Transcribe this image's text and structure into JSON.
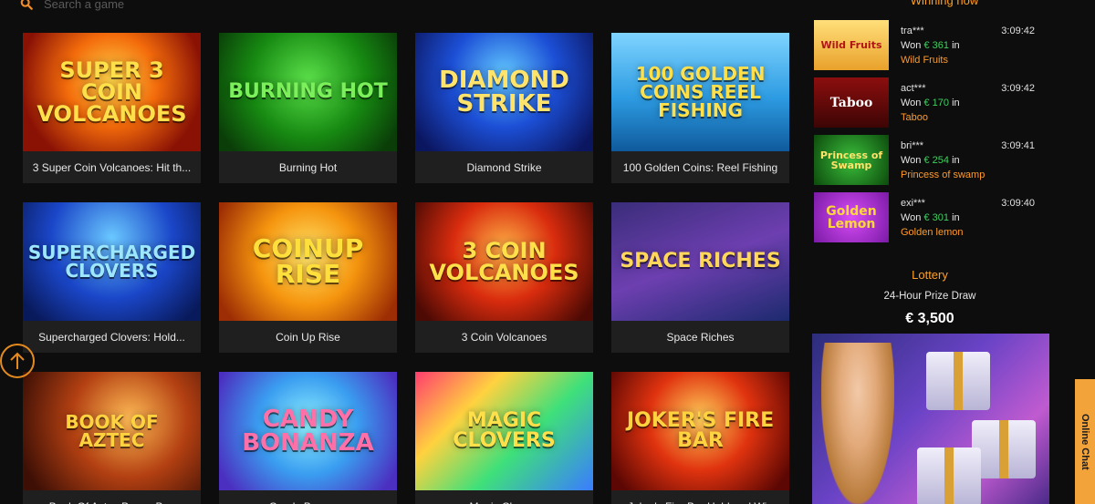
{
  "search": {
    "placeholder": "Search a game",
    "icon": "search-icon",
    "icon_color": "#f28c28"
  },
  "games": [
    {
      "name": "3 Super Coin Volcanoes: Hit th...",
      "art": "Super 3 Coin Volcanoes"
    },
    {
      "name": "Burning Hot",
      "art": "Burning Hot"
    },
    {
      "name": "Diamond Strike",
      "art": "Diamond Strike"
    },
    {
      "name": "100 Golden Coins: Reel Fishing",
      "art": "100 Golden Coins Reel Fishing"
    },
    {
      "name": "Supercharged Clovers: Hold...",
      "art": "Supercharged Clovers"
    },
    {
      "name": "Coin Up Rise",
      "art": "Coinup Rise"
    },
    {
      "name": "3 Coin Volcanoes",
      "art": "3 Coin Volcanoes"
    },
    {
      "name": "Space Riches",
      "art": "Space Riches"
    },
    {
      "name": "Book Of Aztec Bonus Buy",
      "art": "Book of Aztec"
    },
    {
      "name": "Candy Bonanza",
      "art": "Candy Bonanza"
    },
    {
      "name": "Magic Clovers",
      "art": "Magic Clovers"
    },
    {
      "name": "Joker's Fire Bar Hold and Win",
      "art": "Joker's Fire Bar"
    }
  ],
  "winners": {
    "title": "Winning now",
    "items": [
      {
        "user": "tra***",
        "time": "3:09:42",
        "won_label": "Won",
        "amount": "€ 361",
        "in_label": "in",
        "game": "Wild Fruits",
        "thumb": "Wild Fruits"
      },
      {
        "user": "act***",
        "time": "3:09:42",
        "won_label": "Won",
        "amount": "€ 170",
        "in_label": "in",
        "game": "Taboo",
        "thumb": "Taboo"
      },
      {
        "user": "bri***",
        "time": "3:09:41",
        "won_label": "Won",
        "amount": "€ 254",
        "in_label": "in",
        "game": "Princess of swamp",
        "thumb": "Princess of Swamp"
      },
      {
        "user": "exi***",
        "time": "3:09:40",
        "won_label": "Won",
        "amount": "€ 301",
        "in_label": "in",
        "game": "Golden lemon",
        "thumb": "Golden Lemon"
      }
    ]
  },
  "lottery": {
    "title": "Lottery",
    "subtitle": "24-Hour Prize Draw",
    "prize": "€ 3,500"
  },
  "chat": {
    "label": "Online Chat"
  },
  "colors": {
    "accent": "#ffa024",
    "amount": "#3fd05f",
    "background": "#0d0d0d",
    "card": "#1f1f1f"
  }
}
